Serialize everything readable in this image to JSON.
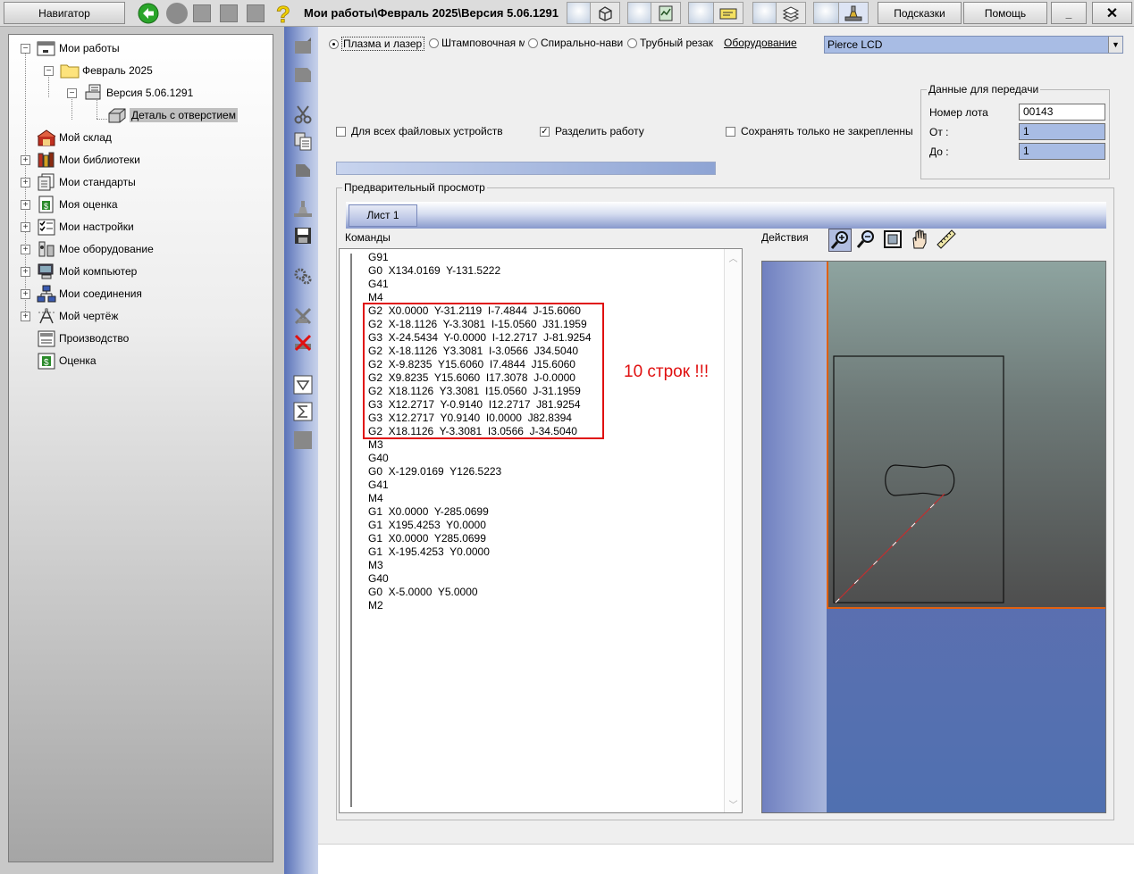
{
  "topbar": {
    "navigator_label": "Навигатор",
    "title": "Мои работы\\Февраль 2025\\Версия 5.06.1291",
    "hints_label": "Подсказки",
    "help_label": "Помощь",
    "minimize_glyph": "_",
    "close_glyph": "✕"
  },
  "tree": {
    "items": [
      {
        "label": "Мои работы"
      },
      {
        "label": "Февраль 2025"
      },
      {
        "label": "Версия 5.06.1291"
      },
      {
        "label": "Деталь с отверстием"
      },
      {
        "label": "Мой склад"
      },
      {
        "label": "Мои библиотеки"
      },
      {
        "label": "Мои стандарты"
      },
      {
        "label": "Моя оценка"
      },
      {
        "label": "Мои настройки"
      },
      {
        "label": "Мое оборудование"
      },
      {
        "label": "Мой компьютер"
      },
      {
        "label": "Мои соединения"
      },
      {
        "label": "Мой чертёж"
      },
      {
        "label": "Производство"
      },
      {
        "label": "Оценка"
      }
    ]
  },
  "process": {
    "options": [
      {
        "label": "Плазма и лазер",
        "selected": true
      },
      {
        "label": "Штамповочная м",
        "selected": false
      },
      {
        "label": "Спирально-нави",
        "selected": false
      },
      {
        "label": "Трубный резак",
        "selected": false
      }
    ],
    "equipment_label": "Оборудование",
    "equipment_value": "Pierce LCD"
  },
  "checkboxes": [
    {
      "label": "Для всех файловых устройств",
      "checked": false
    },
    {
      "label": "Разделить работу",
      "checked": true
    },
    {
      "label": "Сохранять только не закрепленны",
      "checked": false
    }
  ],
  "transfer": {
    "title": "Данные для передачи",
    "lot_label": "Номер лота",
    "lot_value": "00143",
    "from_label": "От :",
    "from_value": "1",
    "to_label": "До :",
    "to_value": "1"
  },
  "preview": {
    "title": "Предварительный просмотр",
    "tab_label": "Лист 1",
    "commands_label": "Команды",
    "actions_label": "Действия",
    "annotation": "10 строк !!!",
    "commands": [
      "G91",
      "G0  X134.0169  Y-131.5222",
      "G41",
      "M4",
      "G2  X0.0000  Y-31.2119  I-7.4844  J-15.6060",
      "G2  X-18.1126  Y-3.3081  I-15.0560  J31.1959",
      "G3  X-24.5434  Y-0.0000  I-12.2717  J-81.9254",
      "G2  X-18.1126  Y3.3081  I-3.0566  J34.5040",
      "G2  X-9.8235  Y15.6060  I7.4844  J15.6060",
      "G2  X9.8235  Y15.6060  I17.3078  J-0.0000",
      "G2  X18.1126  Y3.3081  I15.0560  J-31.1959",
      "G3  X12.2717  Y-0.9140  I12.2717  J81.9254",
      "G3  X12.2717  Y0.9140  I0.0000  J82.8394",
      "G2  X18.1126  Y-3.3081  I3.0566  J-34.5040",
      "M3",
      "G40",
      "G0  X-129.0169  Y126.5223",
      "G41",
      "M4",
      "G1  X0.0000  Y-285.0699",
      "G1  X195.4253  Y0.0000",
      "G1  X0.0000  Y285.0699",
      "G1  X-195.4253  Y0.0000",
      "M3",
      "G40",
      "G0  X-5.0000  Y5.0000",
      "M2"
    ]
  },
  "colors": {
    "accent_blue": "#a8bce4",
    "highlight_red": "#e01010",
    "sheet_edge_orange": "#e06010"
  }
}
